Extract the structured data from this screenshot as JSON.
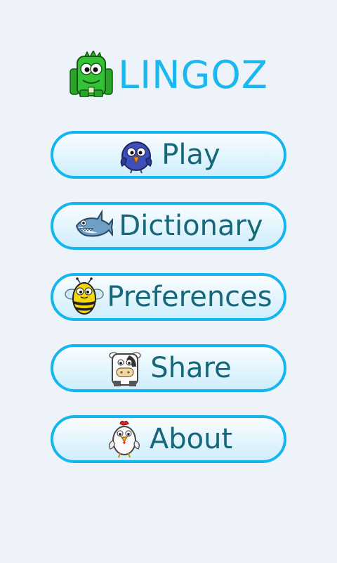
{
  "app": {
    "title": "LINGOZ",
    "logo_icon": "green-monster-icon",
    "accent_color": "#1ab8ef"
  },
  "menu": {
    "items": [
      {
        "label": "Play",
        "icon": "blue-bird-icon"
      },
      {
        "label": "Dictionary",
        "icon": "shark-icon"
      },
      {
        "label": "Preferences",
        "icon": "bee-icon"
      },
      {
        "label": "Share",
        "icon": "cow-icon"
      },
      {
        "label": "About",
        "icon": "chicken-icon"
      }
    ],
    "border_color": "#13b6ee",
    "text_color": "#16677a"
  }
}
